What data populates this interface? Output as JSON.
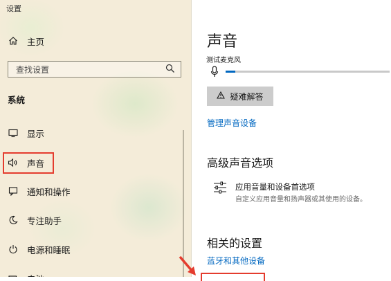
{
  "window": {
    "title": "设置"
  },
  "left_nav": {
    "home": {
      "label": "主页",
      "icon": "home-icon"
    },
    "search": {
      "placeholder": "查找设置",
      "icon": "search-icon"
    },
    "section": "系统",
    "items": [
      {
        "label": "显示",
        "icon": "display-icon",
        "active": false
      },
      {
        "label": "声音",
        "icon": "speaker-icon",
        "active": true
      },
      {
        "label": "通知和操作",
        "icon": "notification-icon",
        "active": false
      },
      {
        "label": "专注助手",
        "icon": "moon-icon",
        "active": false
      },
      {
        "label": "电源和睡眠",
        "icon": "power-icon",
        "active": false
      },
      {
        "label": "电池",
        "icon": "battery-icon",
        "active": false
      }
    ]
  },
  "main": {
    "title": "声音",
    "mic_test_label": "测试麦克风",
    "mic_level": 0.06,
    "troubleshoot_label": "疑难解答",
    "manage_devices_link": "管理声音设备",
    "advanced": {
      "heading": "高级声音选项",
      "item_title": "应用音量和设备首选项",
      "item_desc": "自定义应用音量和扬声器或其使用的设备。"
    },
    "related": {
      "heading": "相关的设置",
      "link_bluetooth": "蓝牙和其他设备"
    }
  },
  "colors": {
    "accent": "#0067c0",
    "annotation": "#e43c2e"
  }
}
